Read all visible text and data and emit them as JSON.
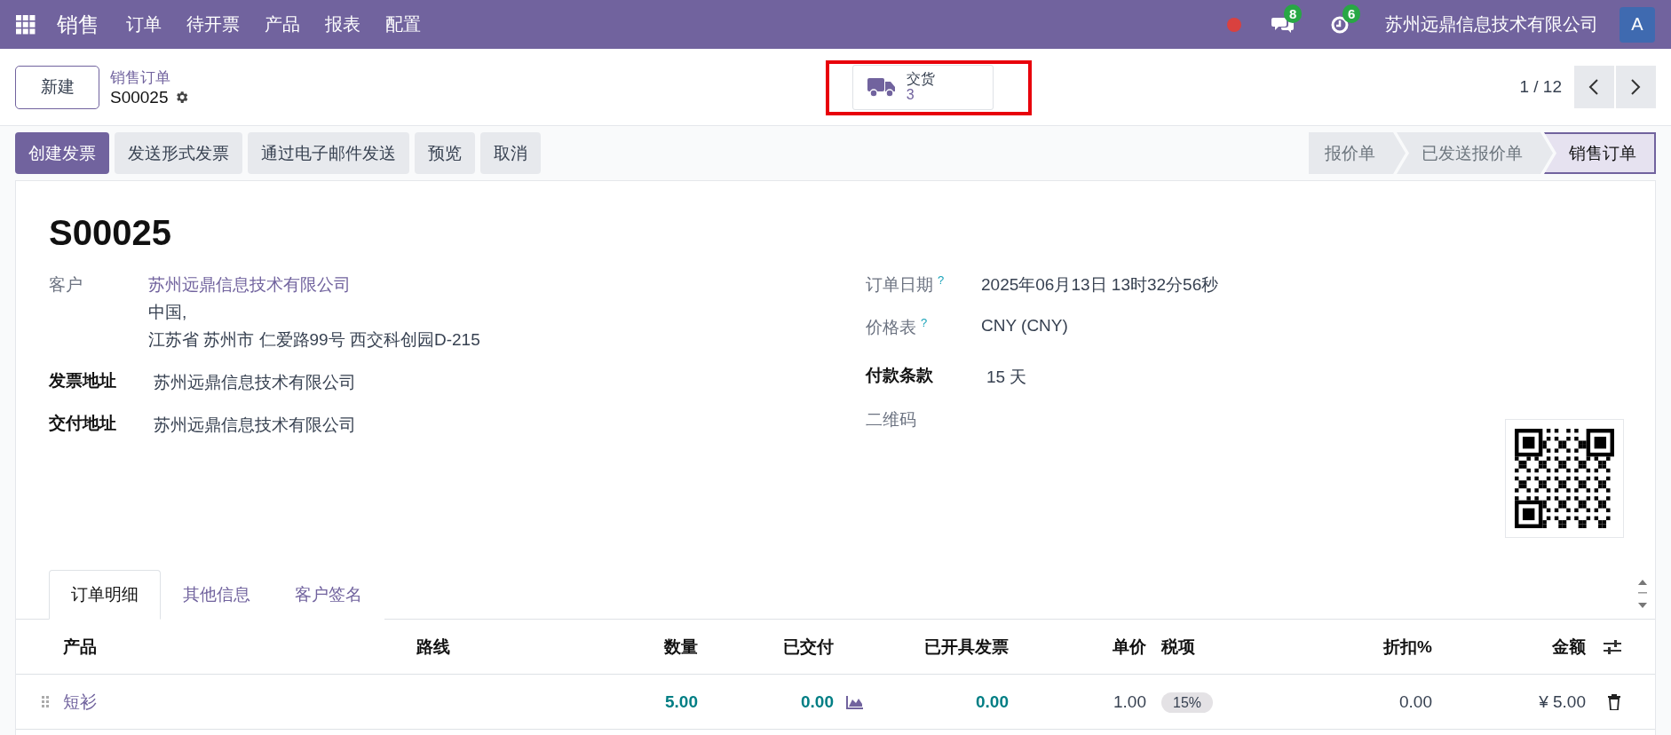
{
  "navbar": {
    "app_name": "销售",
    "menu": [
      "订单",
      "待开票",
      "产品",
      "报表",
      "配置"
    ],
    "chat_count": "8",
    "activity_count": "6",
    "company": "苏州远鼎信息技术有限公司",
    "avatar_letter": "A"
  },
  "control": {
    "new_button": "新建",
    "breadcrumb": "销售订单",
    "record": "S00025",
    "smart_button": {
      "label": "交货",
      "count": "3",
      "highlighted": true
    },
    "pager": "1 / 12"
  },
  "actions": [
    {
      "label": "创建发票",
      "kind": "primary"
    },
    {
      "label": "发送形式发票",
      "kind": "secondary"
    },
    {
      "label": "通过电子邮件发送",
      "kind": "secondary"
    },
    {
      "label": "预览",
      "kind": "secondary"
    },
    {
      "label": "取消",
      "kind": "secondary"
    }
  ],
  "stages": [
    {
      "label": "报价单",
      "selected": false
    },
    {
      "label": "已发送报价单",
      "selected": false
    },
    {
      "label": "销售订单",
      "selected": true
    }
  ],
  "form": {
    "title": "S00025",
    "left_fields": [
      {
        "label": "客户",
        "strong": false,
        "link": "苏州远鼎信息技术有限公司",
        "lines": [
          "中国,",
          "江苏省 苏州市 仁爱路99号 西交科创园D-215"
        ]
      },
      {
        "label": "发票地址",
        "strong": true,
        "lines": [
          "苏州远鼎信息技术有限公司"
        ]
      },
      {
        "label": "交付地址",
        "strong": true,
        "lines": [
          "苏州远鼎信息技术有限公司"
        ]
      }
    ],
    "right_fields": [
      {
        "label": "订单日期",
        "strong": false,
        "help": "?",
        "value": "2025年06月13日 13时32分56秒"
      },
      {
        "label": "价格表",
        "strong": false,
        "help": "?",
        "value": "CNY (CNY)"
      },
      {
        "label": "付款条款",
        "strong": true,
        "value": "15 天"
      },
      {
        "label": "二维码",
        "strong": false,
        "kind": "qr"
      }
    ]
  },
  "tabs": [
    {
      "label": "订单明细",
      "selected": true
    },
    {
      "label": "其他信息",
      "selected": false
    },
    {
      "label": "客户签名",
      "selected": false
    }
  ],
  "table": {
    "columns": [
      "产品",
      "路线",
      "数量",
      "已交付",
      "已开具发票",
      "单价",
      "税项",
      "折扣%",
      "金额"
    ],
    "rows": [
      {
        "product": "短衫",
        "quantity": "5.00",
        "delivered": "0.00",
        "invoiced": "0.00",
        "unit_price": "1.00",
        "tax": "15%",
        "discount": "0.00",
        "amount": "¥ 5.00"
      }
    ]
  }
}
